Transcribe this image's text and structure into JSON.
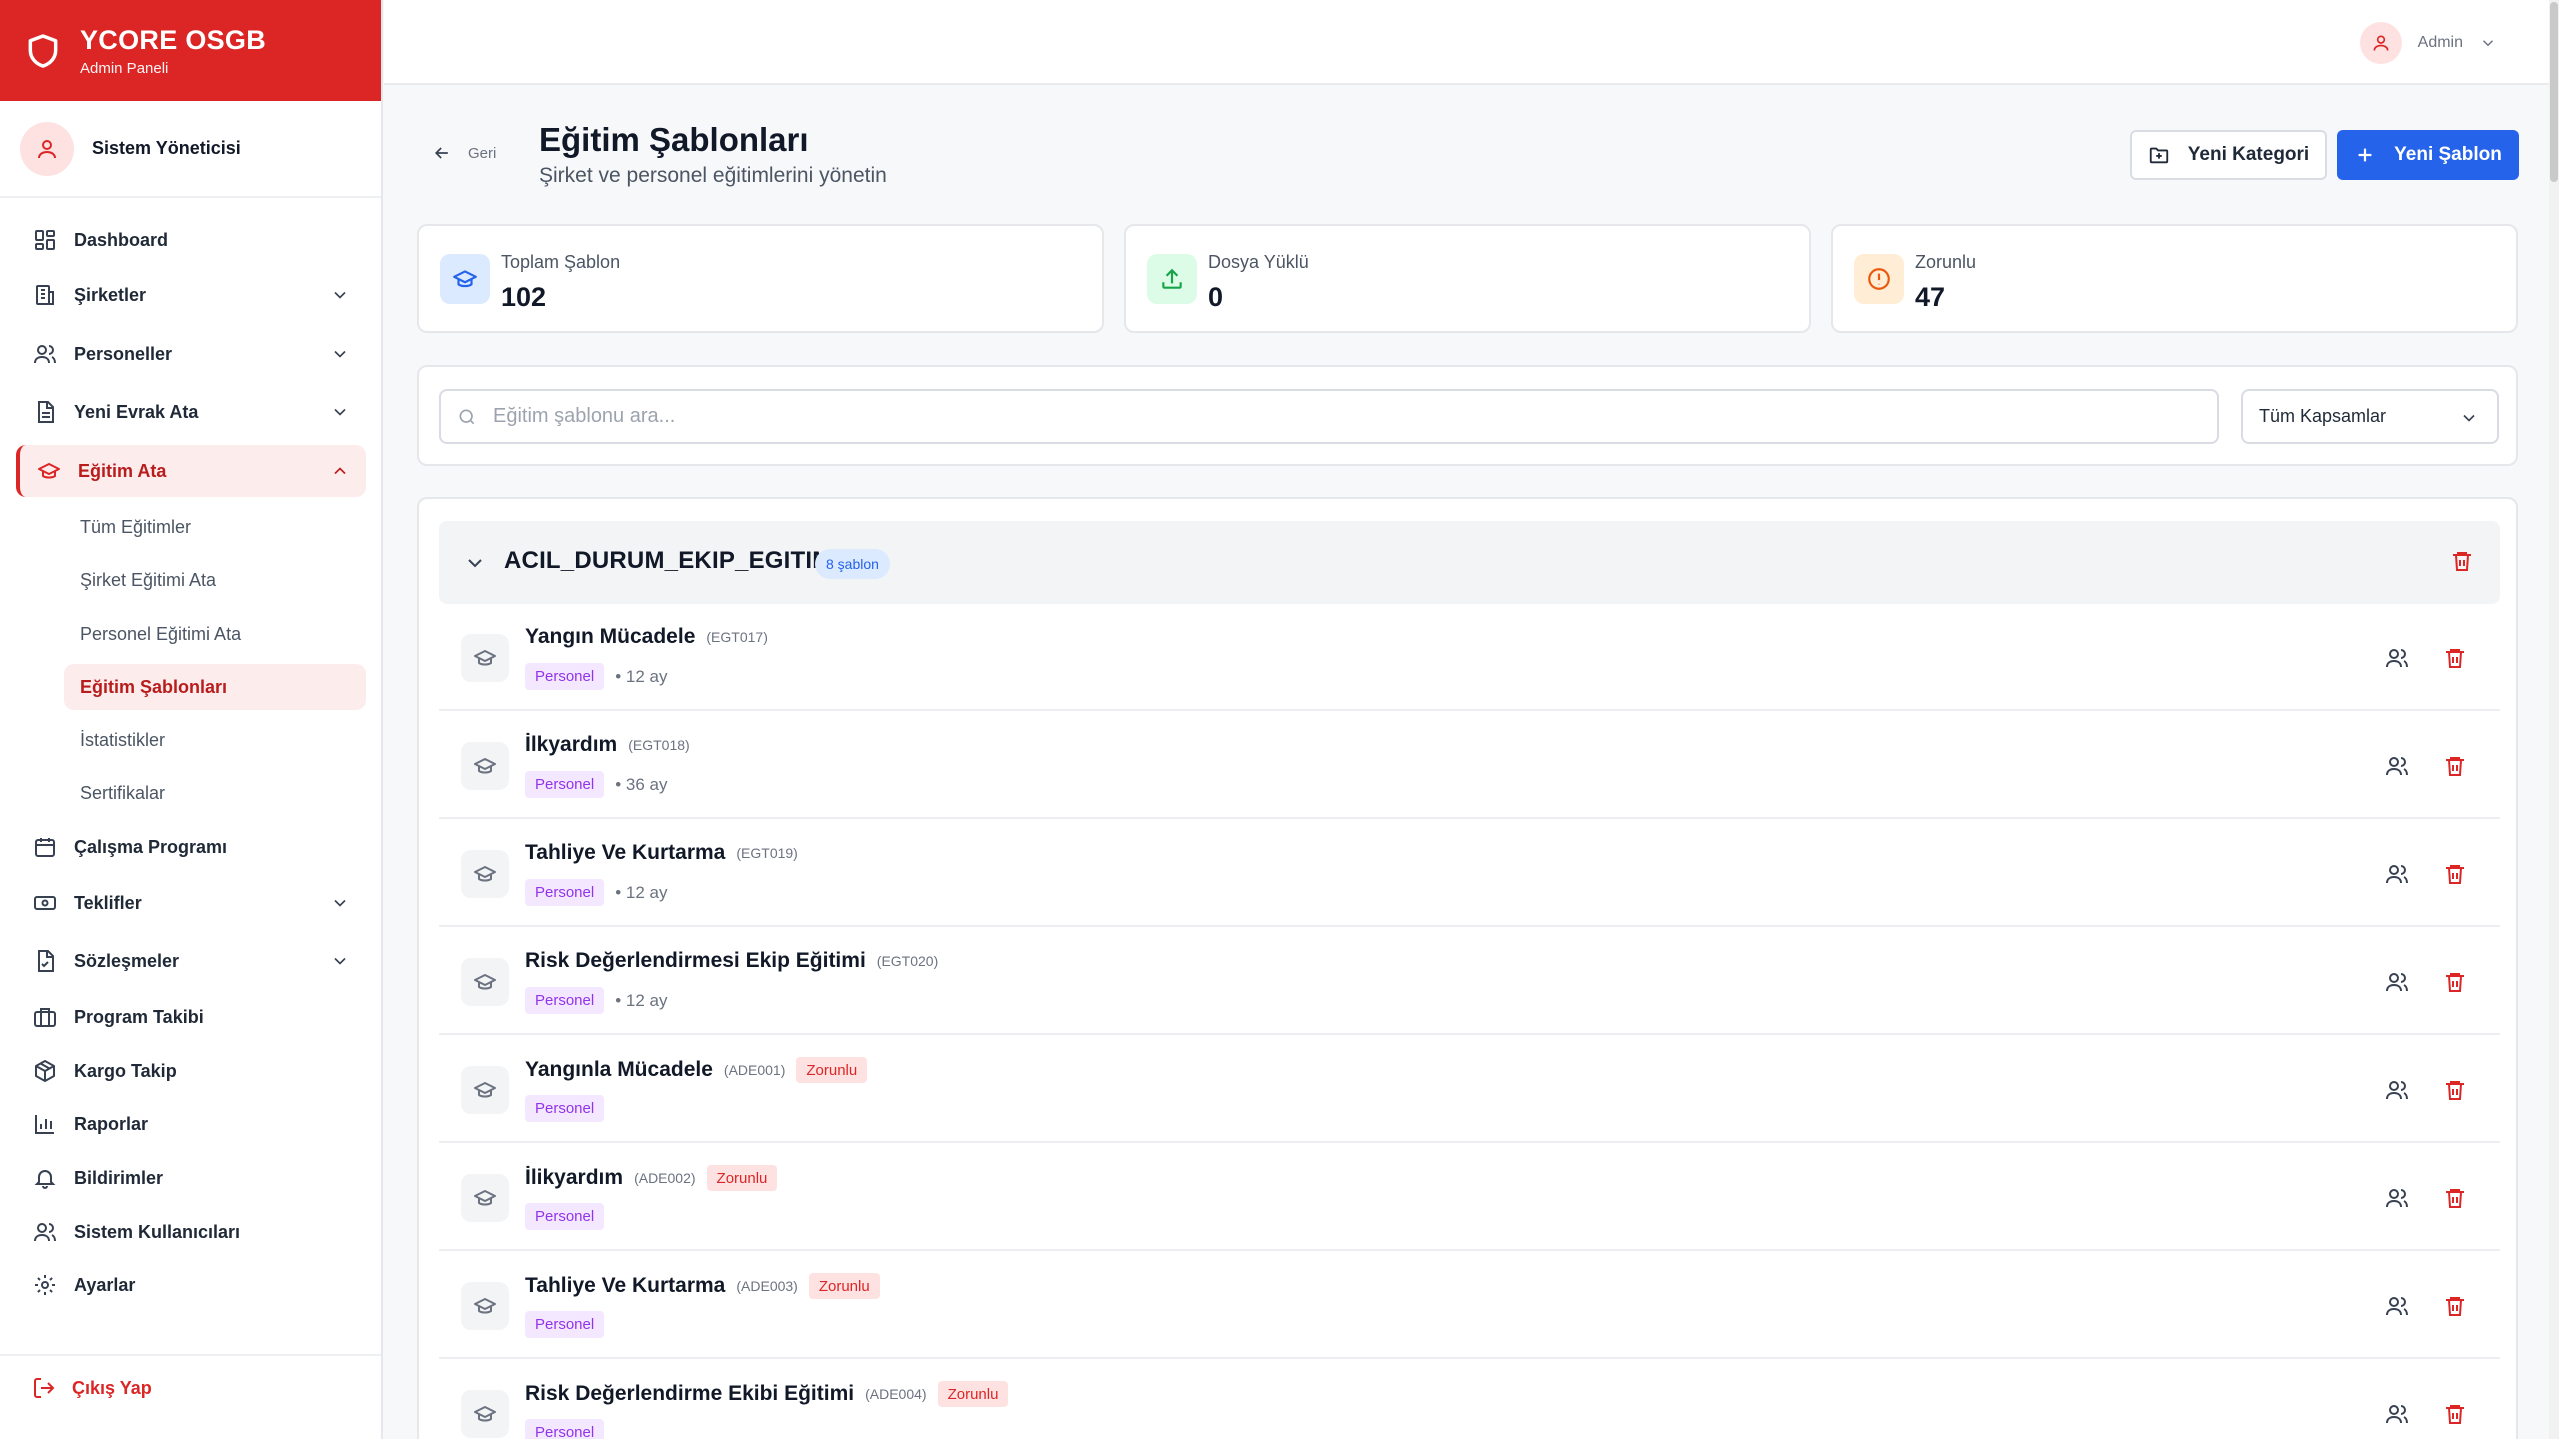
{
  "brand": {
    "title": "YCORE OSGB",
    "subtitle": "Admin Paneli"
  },
  "profile": {
    "name": "Sistem Yöneticisi"
  },
  "nav": {
    "dashboard": "Dashboard",
    "sirketler": "Şirketler",
    "personeller": "Personeller",
    "yeni_evrak": "Yeni Evrak Ata",
    "egitim_ata": "Eğitim Ata",
    "sub": {
      "tum_egitimler": "Tüm Eğitimler",
      "sirket_egitimi": "Şirket Eğitimi Ata",
      "personel_egitimi": "Personel Eğitimi Ata",
      "egitim_sablonlari": "Eğitim Şablonları",
      "istatistikler": "İstatistikler",
      "sertifikalar": "Sertifikalar"
    },
    "calisma_programi": "Çalışma Programı",
    "teklifler": "Teklifler",
    "sozlesmeler": "Sözleşmeler",
    "program_takibi": "Program Takibi",
    "kargo_takip": "Kargo Takip",
    "raporlar": "Raporlar",
    "bildirimler": "Bildirimler",
    "sistem_kullanicilari": "Sistem Kullanıcıları",
    "ayarlar": "Ayarlar",
    "logout": "Çıkış Yap"
  },
  "topbar": {
    "user": "Admin"
  },
  "header": {
    "back": "Geri",
    "title": "Eğitim Şablonları",
    "subtitle": "Şirket ve personel eğitimlerini yönetin",
    "new_category": "Yeni Kategori",
    "new_template": "Yeni Şablon"
  },
  "stats": [
    {
      "label": "Toplam Şablon",
      "value": "102"
    },
    {
      "label": "Dosya Yüklü",
      "value": "0"
    },
    {
      "label": "Zorunlu",
      "value": "47"
    }
  ],
  "search": {
    "placeholder": "Eğitim şablonu ara...",
    "value": ""
  },
  "filter": {
    "selected": "Tüm Kapsamlar"
  },
  "category": {
    "name": "ACIL_DURUM_EKIP_EGITIM",
    "count": "8 şablon",
    "items": [
      {
        "name": "Yangın Mücadele",
        "code": "(EGT017)",
        "required": "",
        "tag": "Personel",
        "duration": "• 12 ay"
      },
      {
        "name": "İlkyardım",
        "code": "(EGT018)",
        "required": "",
        "tag": "Personel",
        "duration": "• 36 ay"
      },
      {
        "name": "Tahliye Ve Kurtarma",
        "code": "(EGT019)",
        "required": "",
        "tag": "Personel",
        "duration": "• 12 ay"
      },
      {
        "name": "Risk Değerlendirmesi Ekip Eğitimi",
        "code": "(EGT020)",
        "required": "",
        "tag": "Personel",
        "duration": "• 12 ay"
      },
      {
        "name": "Yangınla Mücadele",
        "code": "(ADE001)",
        "required": "Zorunlu",
        "tag": "Personel",
        "duration": ""
      },
      {
        "name": "İlikyardım",
        "code": "(ADE002)",
        "required": "Zorunlu",
        "tag": "Personel",
        "duration": ""
      },
      {
        "name": "Tahliye Ve Kurtarma",
        "code": "(ADE003)",
        "required": "Zorunlu",
        "tag": "Personel",
        "duration": ""
      },
      {
        "name": "Risk Değerlendirme Ekibi Eğitimi",
        "code": "(ADE004)",
        "required": "Zorunlu",
        "tag": "Personel",
        "duration": ""
      }
    ]
  },
  "colors": {
    "brand": "#dc2626",
    "primary": "#2563eb",
    "tag": "#9333ea",
    "required": "#dc2626"
  }
}
